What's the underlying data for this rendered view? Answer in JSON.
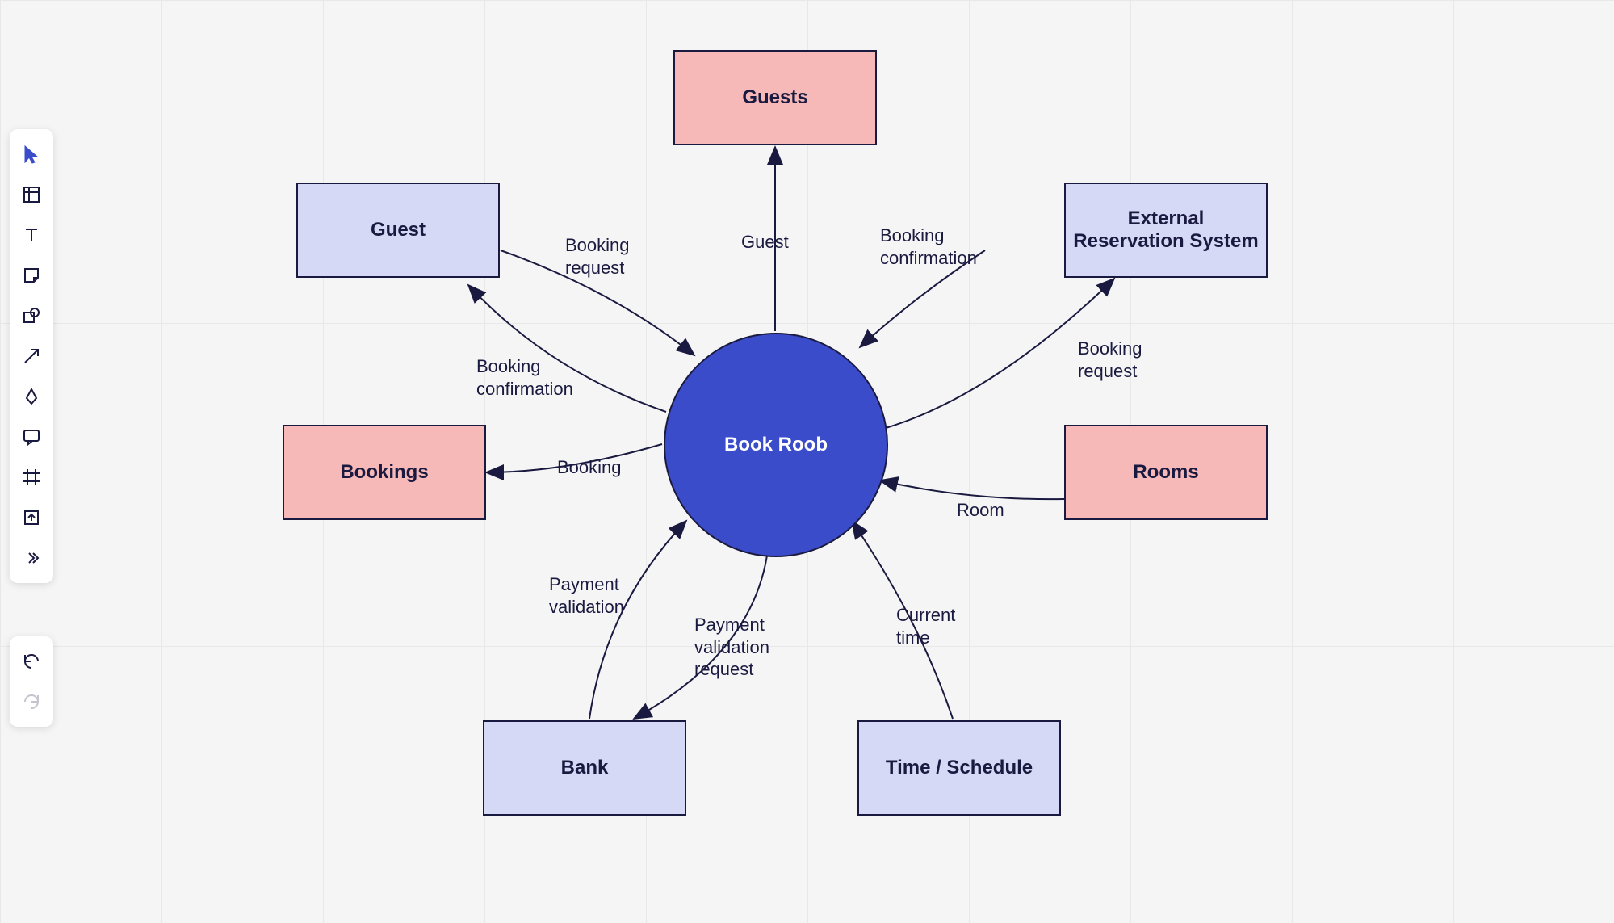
{
  "toolbar": {
    "tools": [
      {
        "name": "pointer-tool",
        "icon": "pointer"
      },
      {
        "name": "frame-tool",
        "icon": "frame"
      },
      {
        "name": "text-tool",
        "icon": "text"
      },
      {
        "name": "sticky-tool",
        "icon": "sticky"
      },
      {
        "name": "shape-tool",
        "icon": "shape"
      },
      {
        "name": "arrow-tool",
        "icon": "arrow"
      },
      {
        "name": "pen-tool",
        "icon": "pen"
      },
      {
        "name": "comment-tool",
        "icon": "comment"
      },
      {
        "name": "grid-tool",
        "icon": "grid"
      },
      {
        "name": "export-tool",
        "icon": "export"
      },
      {
        "name": "more-tool",
        "icon": "more"
      }
    ],
    "history": [
      {
        "name": "undo-button",
        "icon": "undo"
      },
      {
        "name": "redo-button",
        "icon": "redo",
        "disabled": true
      }
    ]
  },
  "diagram": {
    "central": {
      "label": "Book Roob"
    },
    "entities": {
      "guest": "Guest",
      "guests": "Guests",
      "external": "External\nReservation System",
      "bookings": "Bookings",
      "rooms": "Rooms",
      "bank": "Bank",
      "time": "Time / Schedule"
    },
    "edges": {
      "bookingRequest1": "Booking\nrequest",
      "guest": "Guest",
      "bookingConfirmation2": "Booking\nconfirmation",
      "bookingConfirmation1": "Booking\nconfirmation",
      "booking": "Booking",
      "paymentValidation": "Payment\nvalidation",
      "paymentValidationRequest": "Payment\nvalidation\nrequest",
      "currentTime": "Current\ntime",
      "room": "Room",
      "bookingRequest2": "Booking\nrequest"
    }
  },
  "colors": {
    "nodeBlue": "#d6d9f5",
    "nodePink": "#f7b8b8",
    "circleFill": "#3b4cca",
    "stroke": "#1a1a40"
  }
}
